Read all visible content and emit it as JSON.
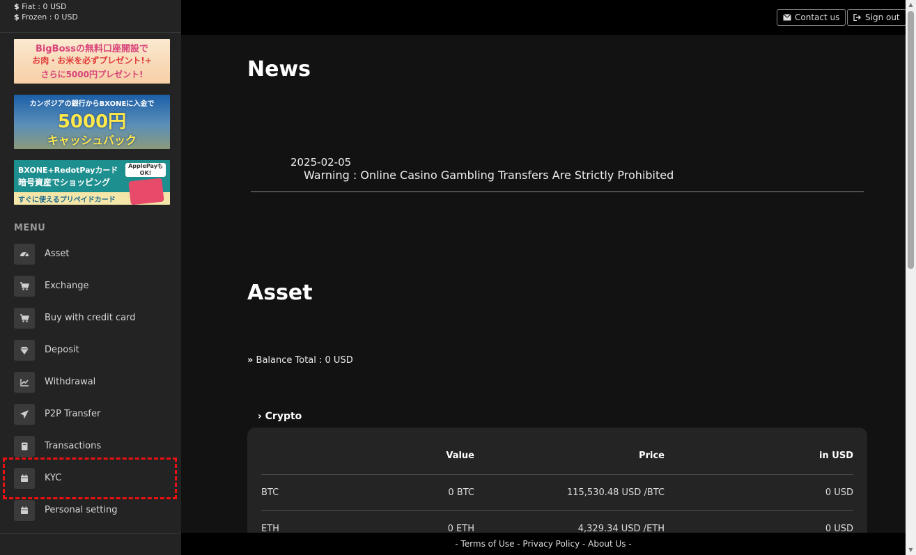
{
  "balances": {
    "symbol": "$",
    "fiat": "Fiat : 0 USD",
    "frozen": "Frozen : 0 USD"
  },
  "banners": {
    "b1_line1": "BigBossの無料口座開設で",
    "b1_line2": "お肉・お米を必ずプレゼント!+",
    "b1_line3": "さらに5000円プレゼント!",
    "b2_line1": "カンボジアの銀行からBXONEに入金で",
    "b2_line2": "5000円",
    "b2_line3": "キャッシュバック",
    "b3_line1": "BXONE+RedotPayカード",
    "b3_line2": "暗号資産でショッピング",
    "b3_line3": "すぐに使えるプリペイドカード",
    "b3_badge": "ApplePayも OK!"
  },
  "menu": {
    "heading": "MENU",
    "items": [
      {
        "label": "Asset",
        "icon": "dashboard-icon"
      },
      {
        "label": "Exchange",
        "icon": "cart-icon"
      },
      {
        "label": "Buy with credit card",
        "icon": "cart-icon"
      },
      {
        "label": "Deposit",
        "icon": "diamond-icon"
      },
      {
        "label": "Withdrawal",
        "icon": "chart-icon"
      },
      {
        "label": "P2P Transfer",
        "icon": "paper-plane-icon"
      },
      {
        "label": "Transactions",
        "icon": "book-icon"
      },
      {
        "label": "KYC",
        "icon": "calendar-icon"
      },
      {
        "label": "Personal setting",
        "icon": "calendar-icon"
      }
    ]
  },
  "topbar": {
    "contact": "Contact us",
    "signout": "Sign out"
  },
  "news": {
    "heading": "News",
    "items": [
      {
        "date": "2025-02-05",
        "title": "Warning : Online Casino Gambling Transfers Are Strictly Prohibited"
      }
    ]
  },
  "asset": {
    "heading": "Asset",
    "balance_total": "Balance Total : 0 USD",
    "section": "Crypto",
    "columns": [
      "Value",
      "Price",
      "in USD"
    ],
    "rows": [
      {
        "coin": "BTC",
        "value": "0 BTC",
        "price": "115,530.48 USD /BTC",
        "usd": "0 USD"
      },
      {
        "coin": "ETH",
        "value": "0 ETH",
        "price": "4,329.34 USD /ETH",
        "usd": "0 USD"
      }
    ]
  },
  "footer": {
    "prefix": "- ",
    "terms": "Terms of Use",
    "sep1": " - ",
    "privacy": "Privacy Policy",
    "sep2": " - ",
    "about": "About Us",
    "suffix": " -"
  },
  "colors": {
    "highlight": "#e11111",
    "sidebar": "#232323",
    "main": "#121212"
  }
}
